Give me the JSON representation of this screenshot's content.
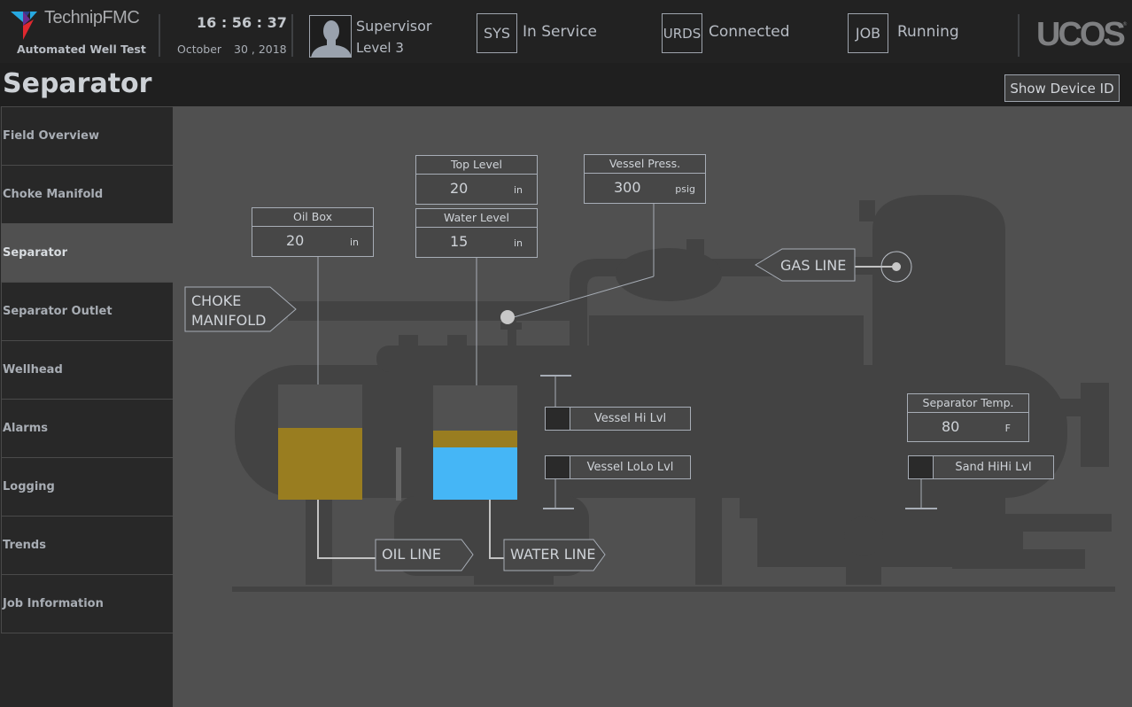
{
  "header": {
    "brand": "TechnipFMC",
    "app_name": "Automated Well Test",
    "time": "16 : 56 : 37",
    "date_month": "October",
    "date_day_year": "30 , 2018",
    "user_role": "Supervisor",
    "user_level": "Level 3",
    "status": [
      {
        "code": "SYS",
        "value": "In Service"
      },
      {
        "code": "URDS",
        "value": "Connected"
      },
      {
        "code": "JOB",
        "value": "Running"
      }
    ],
    "vendor_logo": "UCOS",
    "vendor_reg": "®"
  },
  "titlebar": {
    "title": "Separator",
    "show_device_id_label": "Show Device ID"
  },
  "sidebar": {
    "active": "Separator",
    "items": [
      {
        "label": "Field Overview"
      },
      {
        "label": "Choke Manifold"
      },
      {
        "label": "Separator"
      },
      {
        "label": "Separator Outlet"
      },
      {
        "label": "Wellhead"
      },
      {
        "label": "Alarms"
      },
      {
        "label": "Logging"
      },
      {
        "label": "Trends"
      },
      {
        "label": "Job Information"
      }
    ]
  },
  "diagram": {
    "readouts": {
      "oil_box": {
        "label": "Oil Box",
        "value": "20",
        "unit": "in"
      },
      "top_level": {
        "label": "Top Level",
        "value": "20",
        "unit": "in"
      },
      "water_level": {
        "label": "Water Level",
        "value": "15",
        "unit": "in"
      },
      "vessel_press": {
        "label": "Vessel Press.",
        "value": "300",
        "unit": "psig"
      },
      "separator_temp": {
        "label": "Separator Temp.",
        "value": "80",
        "unit": "F"
      }
    },
    "switches": {
      "vessel_hi_lvl": {
        "label": "Vessel Hi Lvl",
        "active": false
      },
      "vessel_lolo_lvl": {
        "label": "Vessel LoLo Lvl",
        "active": false
      },
      "sand_hihi_lvl": {
        "label": "Sand HiHi Lvl",
        "active": false
      }
    },
    "flags": {
      "choke_manifold_line1": "CHOKE",
      "choke_manifold_line2": "MANIFOLD",
      "gas_line": "GAS LINE",
      "oil_line": "OIL LINE",
      "water_line": "WATER LINE"
    },
    "tanks": {
      "oil_box": {
        "oil_fill_fraction": 0.62
      },
      "water_box": {
        "oil_fill_fraction": 0.15,
        "water_fill_fraction": 0.46
      }
    },
    "colors": {
      "oil": "#997d20",
      "water": "#45b6f6",
      "tank_empty": "#515151",
      "equipment": "#434343"
    }
  }
}
